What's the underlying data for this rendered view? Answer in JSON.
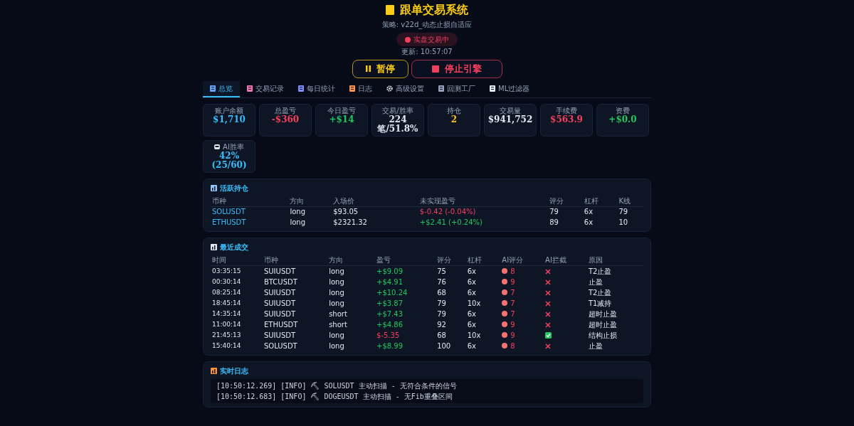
{
  "header": {
    "title": "跟单交易系统",
    "subtitle": "策略: v22d_动态止损自适应",
    "status_badge": "实盘交易中",
    "updated": "更新: 10:57:07"
  },
  "buttons": [
    {
      "kind": "pause",
      "label": "暂停"
    },
    {
      "kind": "stop",
      "label": "停止引擎"
    }
  ],
  "tabs": [
    {
      "label": "总览",
      "selected": true
    },
    {
      "label": "交易记录",
      "selected": false
    },
    {
      "label": "每日统计",
      "selected": false
    },
    {
      "label": "日志",
      "selected": false
    },
    {
      "label": "高级设置",
      "selected": false
    },
    {
      "label": "回测工厂",
      "selected": false
    },
    {
      "label": "ML过滤器",
      "selected": false
    }
  ],
  "stats": [
    {
      "label": "账户余额",
      "value": "$1,710",
      "color": "#38bdf8"
    },
    {
      "label": "总盈亏",
      "value": "-$360",
      "color": "#f43f5e"
    },
    {
      "label": "今日盈亏",
      "value": "+$14",
      "color": "#22c55e"
    },
    {
      "label": "交易/胜率",
      "value": "224笔/51.8%",
      "color": "#e2e8f0"
    },
    {
      "label": "持仓",
      "value": "2",
      "color": "#fbbf24"
    },
    {
      "label": "交易量",
      "value": "$941,752",
      "color": "#e2e8f0"
    },
    {
      "label": "手续费",
      "value": "$563.9",
      "color": "#f43f5e"
    },
    {
      "label": "资费",
      "value": "+$0.0",
      "color": "#22c55e"
    },
    {
      "label": "AI胜率",
      "value": "42% (25/60)",
      "color": "#38bdf8"
    }
  ],
  "positions": {
    "title": "活跃持仓",
    "columns": [
      "币种",
      "方向",
      "入场价",
      "未实现盈亏",
      "评分",
      "杠杆",
      "K线"
    ],
    "rows": [
      {
        "symbol": "SOLUSDT",
        "side": "long",
        "entry": "$93.05",
        "pnl": "$-0.42 (-0.04%)",
        "color": "#f43f5e",
        "score": "79",
        "leverage": "6x",
        "bars": "79"
      },
      {
        "symbol": "ETHUSDT",
        "side": "long",
        "entry": "$2321.32",
        "pnl": "+$2.41 (+0.24%)",
        "color": "#22c55e",
        "score": "89",
        "leverage": "6x",
        "bars": "10"
      }
    ]
  },
  "trades": {
    "title": "最近成交",
    "columns": [
      "时间",
      "币种",
      "方向",
      "盈亏",
      "评分",
      "杠杆",
      "AI评分",
      "AI拦截",
      "原因"
    ],
    "rows": [
      {
        "time": "03:35:15",
        "symbol": "SUIUSDT",
        "side": "long",
        "pnl": "+$9.09",
        "color": "#22c55e",
        "score": "75",
        "leverage": "6x",
        "ai": "8",
        "blocked": false,
        "reason": "T2止盈"
      },
      {
        "time": "00:30:14",
        "symbol": "BTCUSDT",
        "side": "long",
        "pnl": "+$4.91",
        "color": "#22c55e",
        "score": "76",
        "leverage": "6x",
        "ai": "9",
        "blocked": false,
        "reason": "止盈"
      },
      {
        "time": "08:25:14",
        "symbol": "SUIUSDT",
        "side": "long",
        "pnl": "+$10.24",
        "color": "#22c55e",
        "score": "68",
        "leverage": "6x",
        "ai": "7",
        "blocked": false,
        "reason": "T2止盈"
      },
      {
        "time": "18:45:14",
        "symbol": "SUIUSDT",
        "side": "long",
        "pnl": "+$3.87",
        "color": "#22c55e",
        "score": "79",
        "leverage": "10x",
        "ai": "7",
        "blocked": false,
        "reason": "T1减持"
      },
      {
        "time": "14:35:14",
        "symbol": "SUIUSDT",
        "side": "short",
        "pnl": "+$7.43",
        "color": "#22c55e",
        "score": "79",
        "leverage": "6x",
        "ai": "7",
        "blocked": false,
        "reason": "超时止盈"
      },
      {
        "time": "11:00:14",
        "symbol": "ETHUSDT",
        "side": "short",
        "pnl": "+$4.86",
        "color": "#22c55e",
        "score": "92",
        "leverage": "6x",
        "ai": "9",
        "blocked": false,
        "reason": "超时止盈"
      },
      {
        "time": "21:45:13",
        "symbol": "SUIUSDT",
        "side": "long",
        "pnl": "$-5.35",
        "color": "#f43f5e",
        "score": "68",
        "leverage": "10x",
        "ai": "9",
        "blocked": true,
        "reason": "结构止损"
      },
      {
        "time": "15:40:14",
        "symbol": "SOLUSDT",
        "side": "long",
        "pnl": "+$8.99",
        "color": "#22c55e",
        "score": "100",
        "leverage": "6x",
        "ai": "8",
        "blocked": false,
        "reason": "止盈"
      }
    ]
  },
  "logs": {
    "title": "实时日志",
    "lines": [
      "[10:50:12.269] [INFO] ⛏ SOLUSDT 主动扫描 - 无符合条件的信号",
      "[10:50:12.683] [INFO] ⛏ DOGEUSDT 主动扫描 - 无Fib重叠区间"
    ]
  }
}
